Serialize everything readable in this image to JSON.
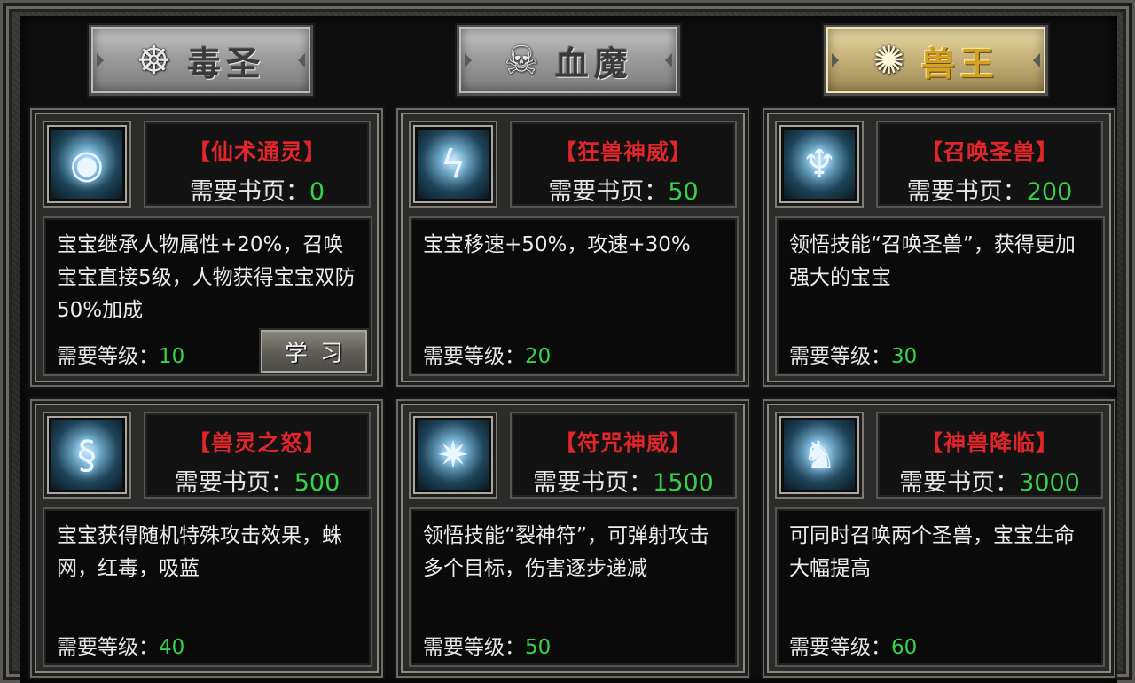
{
  "tabs": [
    {
      "label": "毒圣",
      "icon": "claw-emblem-icon",
      "emblem": "☸",
      "active": false
    },
    {
      "label": "血魔",
      "icon": "demon-face-emblem-icon",
      "emblem": "☠",
      "active": false
    },
    {
      "label": "兽王",
      "icon": "beast-emblem-icon",
      "emblem": "✺",
      "active": true
    }
  ],
  "skills": [
    {
      "name": "【仙术通灵】",
      "pages_label": "需要书页：",
      "pages": "0",
      "desc": "宝宝继承人物属性+20%，召唤宝宝直接5级，人物获得宝宝双防50%加成",
      "level_label": "需要等级：",
      "level": "10",
      "icon": "eye-skill-icon",
      "glyph": "◉",
      "learn_label": "学习"
    },
    {
      "name": "【狂兽神威】",
      "pages_label": "需要书页：",
      "pages": "50",
      "desc": "宝宝移速+50%，攻速+30%",
      "level_label": "需要等级：",
      "level": "20",
      "icon": "lightning-beast-icon",
      "glyph": "ϟ"
    },
    {
      "name": "【召唤圣兽】",
      "pages_label": "需要书页：",
      "pages": "200",
      "desc": "领悟技能“召唤圣兽”，获得更加强大的宝宝",
      "level_label": "需要等级：",
      "level": "30",
      "icon": "horned-demon-icon",
      "glyph": "♆"
    },
    {
      "name": "【兽灵之怒】",
      "pages_label": "需要书页：",
      "pages": "500",
      "desc": "宝宝获得随机特殊攻击效果，蛛网，红毒，吸蓝",
      "level_label": "需要等级：",
      "level": "40",
      "icon": "serpent-rune-icon",
      "glyph": "§"
    },
    {
      "name": "【符咒神威】",
      "pages_label": "需要书页：",
      "pages": "1500",
      "desc": "领悟技能“裂神符”，可弹射攻击多个目标，伤害逐步递减",
      "level_label": "需要等级：",
      "level": "50",
      "icon": "bouncing-talisman-icon",
      "glyph": "✷"
    },
    {
      "name": "【神兽降临】",
      "pages_label": "需要书页：",
      "pages": "3000",
      "desc": "可同时召唤两个圣兽，宝宝生命大幅提高",
      "level_label": "需要等级：",
      "level": "60",
      "icon": "divine-beast-icon",
      "glyph": "♞"
    }
  ],
  "colors": {
    "skill_name": "#e1262b",
    "value_green": "#37d24a",
    "active_tab": "#c7b37a"
  }
}
